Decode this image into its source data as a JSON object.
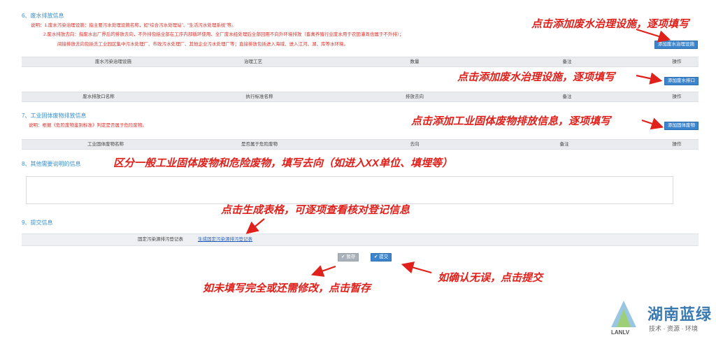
{
  "section6": {
    "title": "6、废水排放信息",
    "notes": [
      "说明：1.废水污染治理设施：指主要污水处理设施名称，如“综合污水处理站”、“生活污水处理系统”等。",
      "2.废水排放去向：指废水出厂界后的排放去向，不外排包括全部在工序内部循环使用、全厂废水经处理后全部回用不向外环境排放（畜禽养殖行业废水用于农田灌溉也属于不外排）；",
      "间接排放去向包括去工业园区集中污水处理厂、市政污水处理厂、其他企业污水处理厂等；直接排放包括进入海域、进入江河、湖、库等水环境。"
    ],
    "add_facility_button": "添加废水治理设施",
    "facility_table_headers": [
      "废水污染治理设施",
      "治理工艺",
      "数量",
      "备注",
      "操作"
    ],
    "add_outlet_button": "添加废水排口",
    "outlet_table_headers": [
      "废水排放口名称",
      "执行标准名称",
      "排放去向",
      "备注",
      "操作"
    ]
  },
  "section7": {
    "title": "7、工业固体废物排放信息",
    "note": "说明：根据《危险废物鉴别标准》判定是否属于危险废物。",
    "add_button": "添加固体废物",
    "table_headers": [
      "工业固体废物名称",
      "是否属于危险废物",
      "去向",
      "备注",
      "操作"
    ]
  },
  "section8": {
    "title": "8、其他需要说明的信息",
    "textarea_value": ""
  },
  "section9": {
    "title": "9、提交信息",
    "row_label": "固定污染源排污登记表",
    "row_link": "生成固定污染源排污登记表"
  },
  "buttons": {
    "save": "暂存",
    "submit": "提交"
  },
  "annotations": {
    "a1": "点击添加废水治理设施，逐项填写",
    "a2": "点击添加废水治理设施，逐项填写",
    "a3": "点击添加工业固体废物排放信息，逐项填写",
    "a4": "区分一般工业固体废物和危险废物，填写去向（如进入XX单位、填埋等）",
    "a5": "点击生成表格，可逐项查看核对登记信息",
    "a6": "如确认无误，点击提交",
    "a7": "如未填写完全或还需修改，点击暂存"
  },
  "logo": {
    "name": "湖南蓝绿",
    "latin": "LANLV",
    "tagline": "技术 · 资源 · 环境"
  },
  "colors": {
    "annotation": "#e0201b",
    "button_blue": "#3c84cc",
    "section_title": "#3a8fd0",
    "note_red": "#d9302a"
  }
}
